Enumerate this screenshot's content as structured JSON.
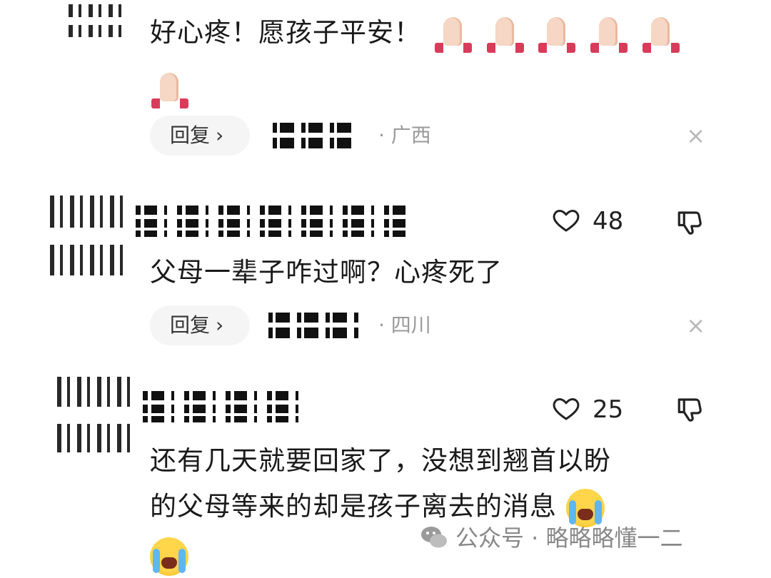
{
  "comments": [
    {
      "text_line1": "好心疼！愿孩子平安！",
      "emoji": "folded-hands",
      "reply_label": "回复",
      "region": "· 广西"
    },
    {
      "text_line1": "父母一辈子咋过啊？心疼死了",
      "likes": "48",
      "reply_label": "回复",
      "region": "· 四川"
    },
    {
      "text_line1": "还有几天就要回家了，没想到翘首以盼",
      "text_line2": "的父母等来的却是孩子离去的消息",
      "emoji": "loudly-crying-face",
      "likes": "25"
    }
  ],
  "close_icon": "×",
  "watermark": {
    "text": "公众号 · 略略略懂一二"
  },
  "colors": {
    "background": "#ffffff",
    "text": "#1a1a1a",
    "muted": "#9a9a9a",
    "pill": "#f5f5f5"
  }
}
